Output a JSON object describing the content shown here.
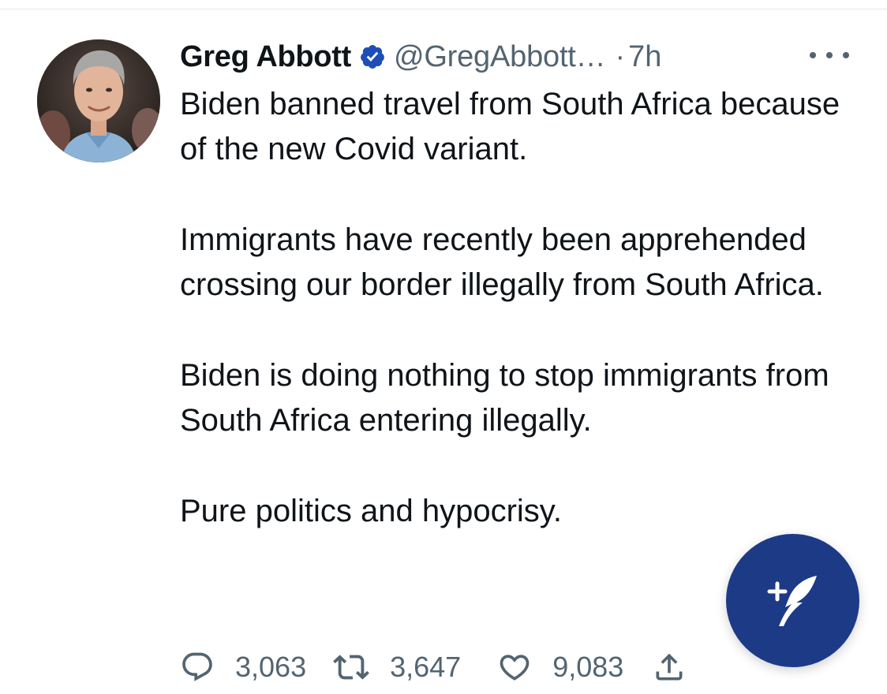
{
  "tweet": {
    "author": {
      "display_name": "Greg Abbott",
      "handle": "@GregAbbott…",
      "verified": true
    },
    "separator": "·",
    "timestamp": "7h",
    "paragraphs": [
      "Biden banned travel from South Africa because of the new Covid variant.",
      "Immigrants have recently been apprehended crossing our border illegally from South Africa.",
      "Biden is doing nothing to stop immigrants from South Africa entering illegally.",
      "Pure politics and hypocrisy."
    ],
    "stats": {
      "replies": "3,063",
      "retweets": "3,647",
      "likes": "9,083"
    }
  },
  "icons": {
    "more": "more-horizontal-icon",
    "verified": "verified-badge-icon",
    "reply": "reply-icon",
    "retweet": "retweet-icon",
    "like": "heart-icon",
    "share": "share-icon",
    "compose": "compose-tweet-icon"
  },
  "colors": {
    "text_primary": "#0f1419",
    "text_secondary": "#536471",
    "verified_blue": "#1d9bf0",
    "fab_background": "#1d3a87"
  }
}
